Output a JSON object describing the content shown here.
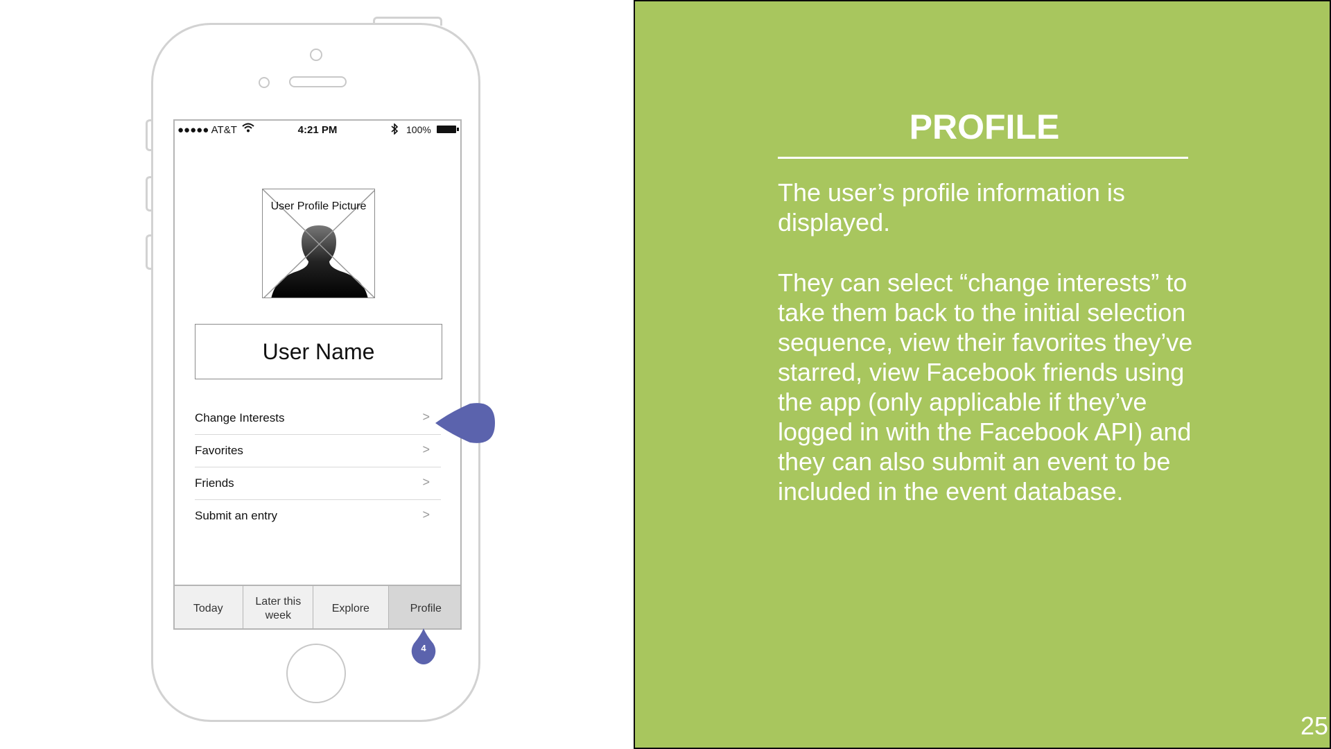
{
  "phone": {
    "status_bar": {
      "carrier": "●●●●● AT&T",
      "wifi_icon": "wifi-icon",
      "time": "4:21 PM",
      "bluetooth_icon": "bluetooth-icon",
      "battery": "100%"
    },
    "avatar_caption": "User Profile Picture",
    "user_name": "User Name",
    "menu": [
      {
        "label": "Change Interests"
      },
      {
        "label": "Favorites"
      },
      {
        "label": "Friends"
      },
      {
        "label": "Submit an entry"
      }
    ],
    "chevron": ">",
    "tabs": [
      {
        "label": "Today"
      },
      {
        "label": "Later this week"
      },
      {
        "label": "Explore"
      },
      {
        "label": "Profile"
      }
    ],
    "active_tab": "Profile",
    "marker_number": "4",
    "marker_color": "#5b63ad"
  },
  "panel": {
    "title": "PROFILE",
    "paragraph1": "The user’s profile information is displayed.",
    "paragraph2": "They can select “change interests” to take them back to the initial selection sequence, view their favorites they’ve starred, view Facebook friends using the app (only applicable if they’ve logged in with the Facebook API) and they can also submit an event to be included in the event database.",
    "page_number": "25",
    "background_color": "#a8c65e"
  }
}
